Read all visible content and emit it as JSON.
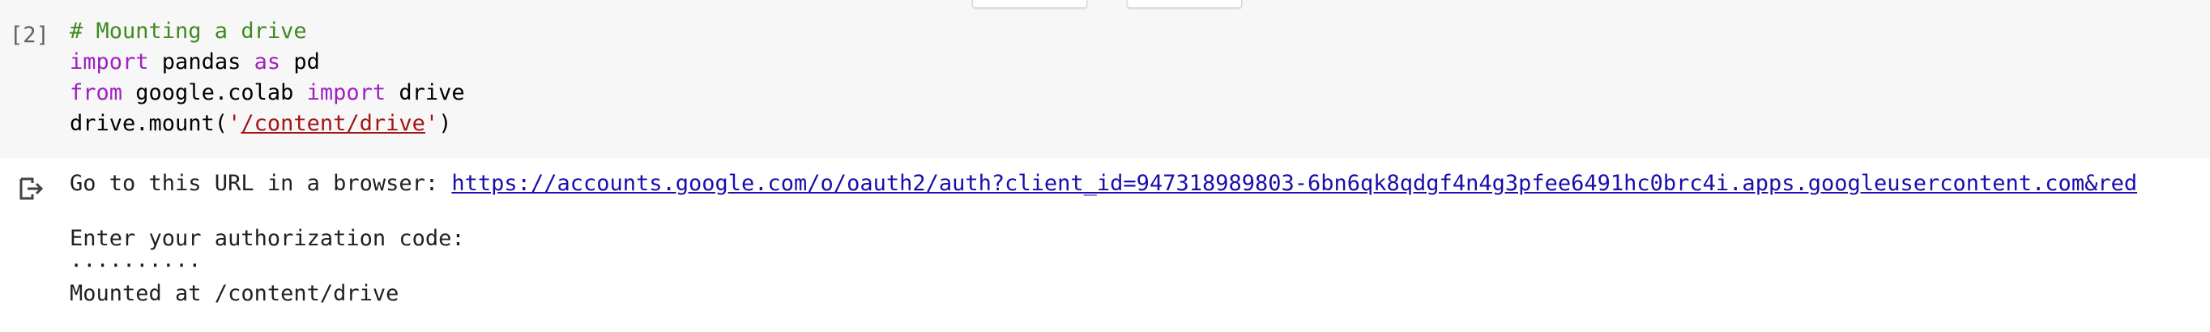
{
  "cell": {
    "execution_count": "[2]",
    "code_lines": [
      {
        "comment": "# Mounting a drive"
      },
      {
        "kw1": "import",
        "t1": " pandas ",
        "kw2": "as",
        "t2": " pd"
      },
      {
        "kw1": "from",
        "t1": " google.colab ",
        "kw2": "import",
        "t2": " drive"
      },
      {
        "t1": "drive.mount(",
        "q1": "'",
        "path": "/content/drive",
        "q2": "'",
        "t2": ")"
      }
    ]
  },
  "output": {
    "icon": "output-arrow-icon",
    "prompt_label": "Go to this URL in a browser: ",
    "url_text": "https://accounts.google.com/o/oauth2/auth?client_id=947318989803-6bn6qk8qdgf4n4g3pfee6491hc0brc4i.apps.googleusercontent.com&red",
    "auth_prompt": "Enter your authorization code:",
    "auth_code_masked": "··········",
    "mounted_message": "Mounted at /content/drive"
  },
  "colors": {
    "cell_background": "#f7f7f7",
    "comment": "#3d8a20",
    "keyword": "#a020c0",
    "string": "#a31515",
    "link": "#1a0dab"
  }
}
